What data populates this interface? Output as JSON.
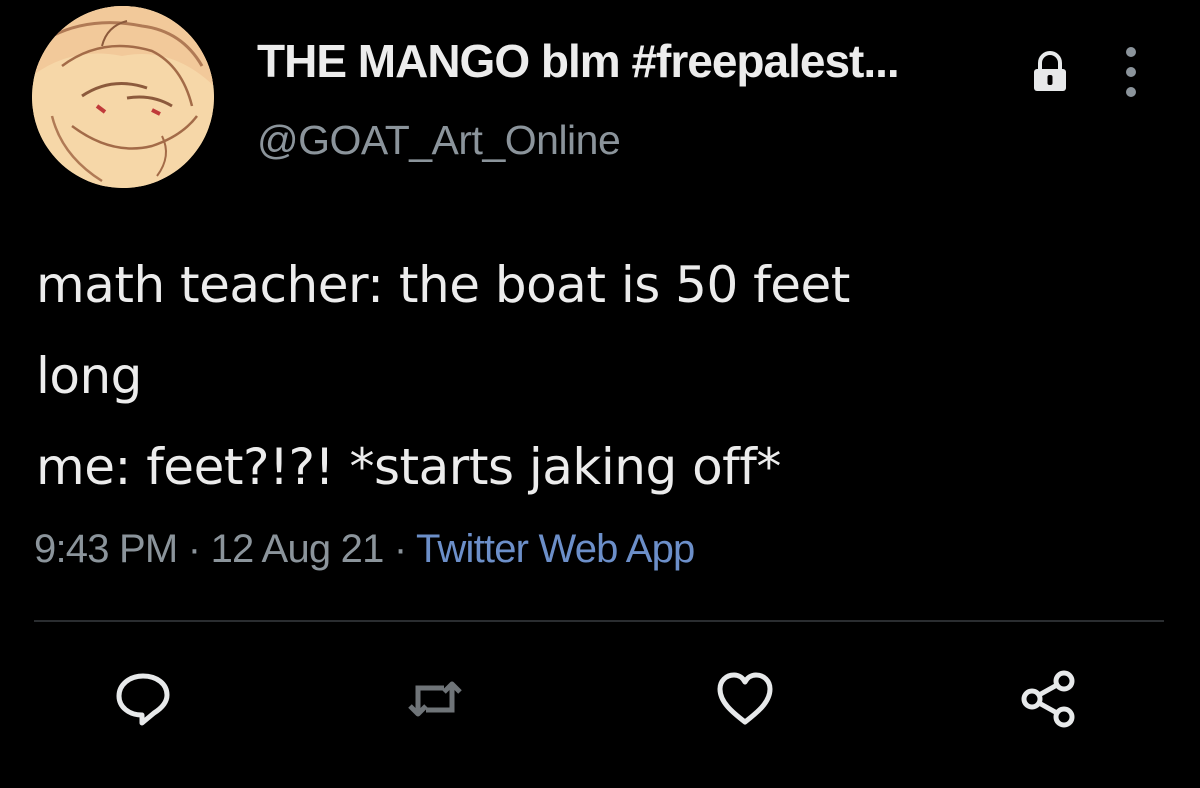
{
  "author": {
    "display_name": "THE MANGO blm #freepalest...",
    "handle": "@GOAT_Art_Online",
    "avatar_icon": "anime-avatar-icon",
    "protected_icon": "lock-icon",
    "more_icon": "more-options-icon"
  },
  "tweet": {
    "lines": [
      "math teacher: the boat is 50 feet",
      "long",
      "me: feet?!?! *starts jaking off*"
    ]
  },
  "meta": {
    "time": "9:43 PM",
    "separator": "·",
    "date": "12 Aug 21",
    "source": "Twitter Web App"
  },
  "actions": {
    "reply_icon": "reply-icon",
    "retweet_icon": "retweet-icon",
    "like_icon": "heart-icon",
    "share_icon": "share-icon"
  },
  "colors": {
    "background": "#000000",
    "text": "#ececec",
    "secondary_text": "#8b949b",
    "link": "#6c8fc9"
  }
}
